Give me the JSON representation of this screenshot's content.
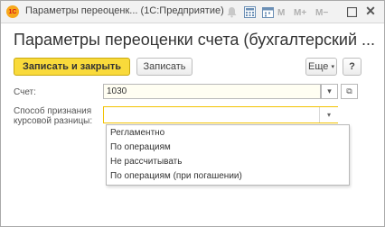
{
  "window": {
    "title": "Параметры переоценк... (1С:Предприятие)",
    "app_icon_text": "1С",
    "m_buttons": [
      "M",
      "M+",
      "M−"
    ],
    "close_glyph": "✕"
  },
  "form": {
    "heading": "Параметры переоценки счета (бухгалтерский ...",
    "toolbar": {
      "save_close_label": "Записать и закрыть",
      "save_label": "Записать",
      "more_label": "Еще",
      "more_caret": "▾",
      "help_label": "?"
    },
    "fields": {
      "account_label": "Счет:",
      "account_value": "1030",
      "method_label_line1": "Способ признания",
      "method_label_line2": "курсовой разницы:",
      "dropdown_glyph": "▾",
      "open_glyph": "⧉"
    },
    "method_options": [
      "Регламентно",
      "По операциям",
      "Не рассчитывать",
      "По операциям (при погашении)"
    ]
  },
  "colors": {
    "primary_button": "#f9da3b",
    "focused_field_border": "#f2c200",
    "field_background": "#fffef2"
  }
}
